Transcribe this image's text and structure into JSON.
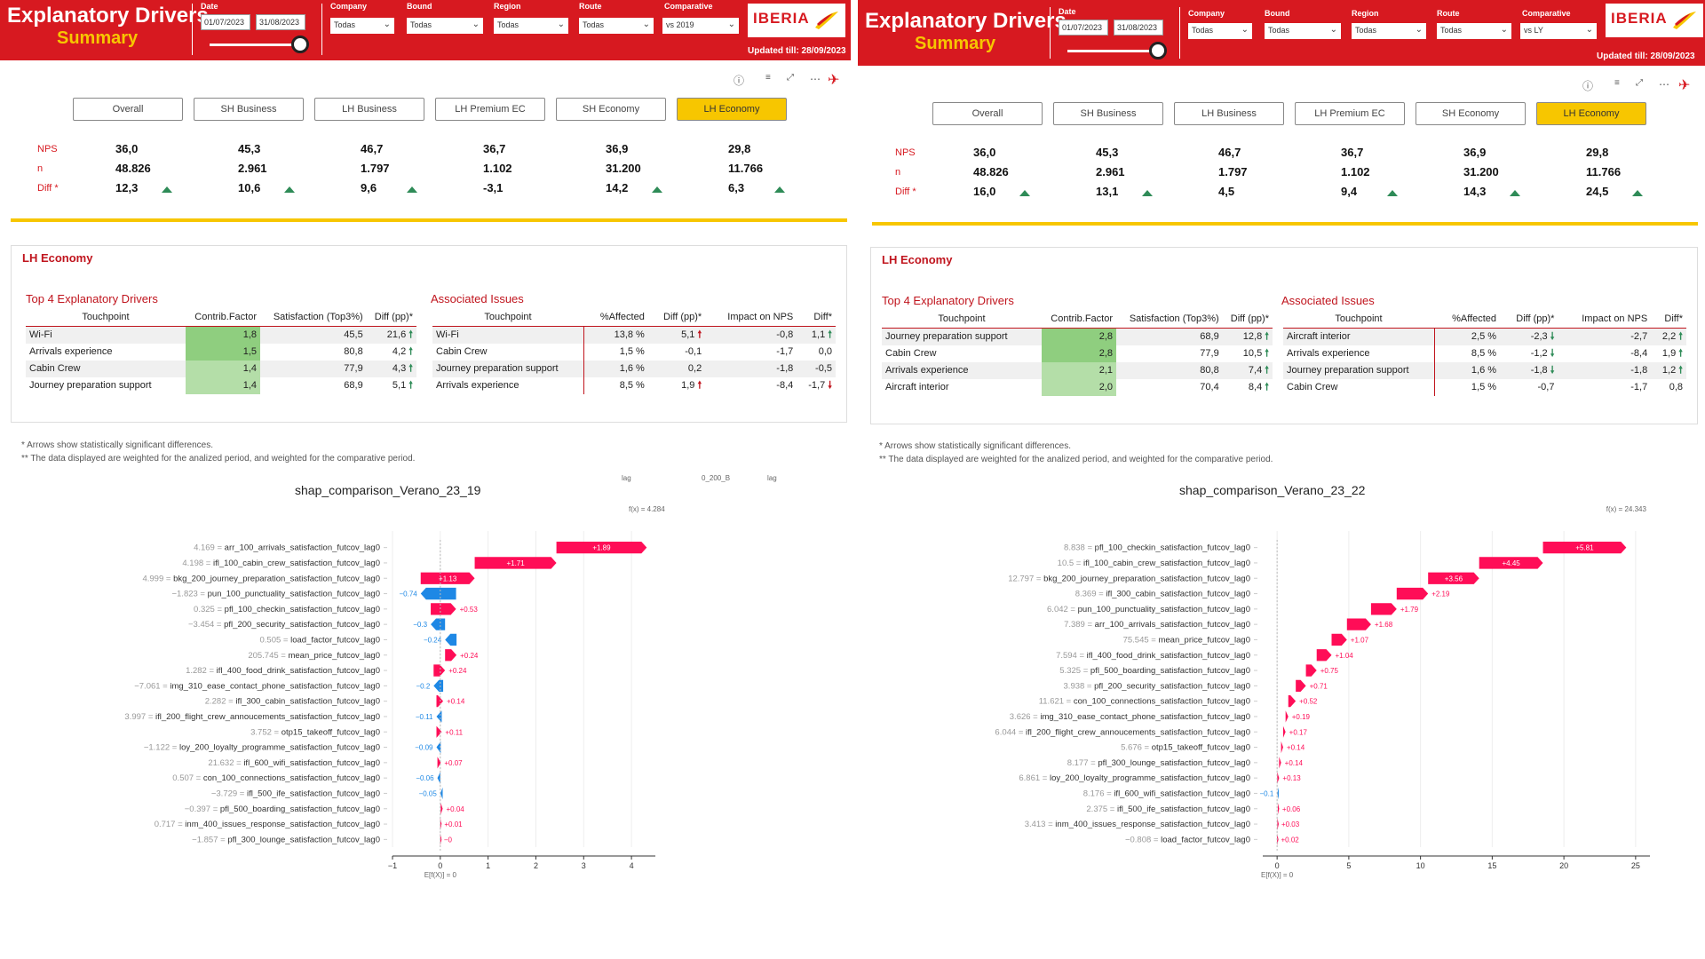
{
  "left": {
    "header": {
      "title": "Explanatory Drivers",
      "subtitle": "Summary",
      "date_label": "Date",
      "date_from": "01/07/2023",
      "date_to": "31/08/2023",
      "filters": [
        {
          "label": "Company",
          "value": "Todas"
        },
        {
          "label": "Bound",
          "value": "Todas"
        },
        {
          "label": "Region",
          "value": "Todas"
        },
        {
          "label": "Route",
          "value": "Todas"
        },
        {
          "label": "Comparative",
          "value": "vs 2019"
        }
      ],
      "logo": "IBERIA",
      "updated": "Updated till: 28/09/2023"
    },
    "tabs": [
      "Overall",
      "SH Business",
      "LH Business",
      "LH Premium EC",
      "SH Economy",
      "LH Economy"
    ],
    "active_tab": 5,
    "kpi": {
      "labels": [
        "NPS",
        "n",
        "Diff *"
      ],
      "cols": [
        [
          "36,0",
          "48.826",
          "12,3"
        ],
        [
          "45,3",
          "2.961",
          "10,6"
        ],
        [
          "46,7",
          "1.797",
          "9,6"
        ],
        [
          "36,7",
          "1.102",
          "-3,1"
        ],
        [
          "36,9",
          "31.200",
          "14,2"
        ],
        [
          "29,8",
          "11.766",
          "6,3"
        ]
      ],
      "diff_arrow": [
        true,
        true,
        true,
        false,
        true,
        true
      ]
    },
    "card_title": "LH Economy",
    "drivers_title": "Top 4 Explanatory Drivers",
    "drivers_headers": [
      "Touchpoint",
      "Contrib.Factor",
      "Satisfaction (Top3%)",
      "Diff (pp)*"
    ],
    "drivers": [
      {
        "tp": "Wi-Fi",
        "cf": "1,8",
        "sat": "45,5",
        "diff": "21,6",
        "arrow": "up-green"
      },
      {
        "tp": "Arrivals experience",
        "cf": "1,5",
        "sat": "80,8",
        "diff": "4,2",
        "arrow": "up-green"
      },
      {
        "tp": "Cabin Crew",
        "cf": "1,4",
        "sat": "77,9",
        "diff": "4,3",
        "arrow": "up-green"
      },
      {
        "tp": "Journey preparation support",
        "cf": "1,4",
        "sat": "68,9",
        "diff": "5,1",
        "arrow": "up-green"
      }
    ],
    "issues_title": "Associated Issues",
    "issues_headers": [
      "Touchpoint",
      "%Affected",
      "Diff (pp)*",
      "Impact on NPS",
      "Diff*"
    ],
    "issues": [
      {
        "tp": "Wi-Fi",
        "aff": "13,8 %",
        "diff": "5,1",
        "a1": "up-red",
        "imp": "-0,8",
        "d2": "1,1",
        "a2": "up-green"
      },
      {
        "tp": "Cabin Crew",
        "aff": "1,5 %",
        "diff": "-0,1",
        "a1": "",
        "imp": "-1,7",
        "d2": "0,0",
        "a2": ""
      },
      {
        "tp": "Journey preparation support",
        "aff": "1,6 %",
        "diff": "0,2",
        "a1": "",
        "imp": "-1,8",
        "d2": "-0,5",
        "a2": ""
      },
      {
        "tp": "Arrivals experience",
        "aff": "8,5 %",
        "diff": "1,9",
        "a1": "up-red",
        "imp": "-8,4",
        "d2": "-1,7",
        "a2": "down-red"
      }
    ],
    "notes": [
      "* Arrows show statistically significant differences.",
      "** The data displayed are weighted for the analized period, and weighted for the comparative period."
    ],
    "stray_glyphs": [
      "lag",
      "0_200_B",
      "lag"
    ]
  },
  "right": {
    "header": {
      "title": "Explanatory Drivers",
      "subtitle": "Summary",
      "date_label": "Date",
      "date_from": "01/07/2023",
      "date_to": "31/08/2023",
      "filters": [
        {
          "label": "Company",
          "value": "Todas"
        },
        {
          "label": "Bound",
          "value": "Todas"
        },
        {
          "label": "Region",
          "value": "Todas"
        },
        {
          "label": "Route",
          "value": "Todas"
        },
        {
          "label": "Comparative",
          "value": "vs LY"
        }
      ],
      "logo": "IBERIA",
      "updated": "Updated till: 28/09/2023"
    },
    "tabs": [
      "Overall",
      "SH Business",
      "LH Business",
      "LH Premium EC",
      "SH Economy",
      "LH Economy"
    ],
    "active_tab": 5,
    "kpi": {
      "labels": [
        "NPS",
        "n",
        "Diff *"
      ],
      "cols": [
        [
          "36,0",
          "48.826",
          "16,0"
        ],
        [
          "45,3",
          "2.961",
          "13,1"
        ],
        [
          "46,7",
          "1.797",
          "4,5"
        ],
        [
          "36,7",
          "1.102",
          "9,4"
        ],
        [
          "36,9",
          "31.200",
          "14,3"
        ],
        [
          "29,8",
          "11.766",
          "24,5"
        ]
      ],
      "diff_arrow": [
        true,
        true,
        false,
        true,
        true,
        true
      ]
    },
    "card_title": "LH Economy",
    "drivers_title": "Top 4 Explanatory Drivers",
    "drivers_headers": [
      "Touchpoint",
      "Contrib.Factor",
      "Satisfaction (Top3%)",
      "Diff (pp)*"
    ],
    "drivers": [
      {
        "tp": "Journey preparation support",
        "cf": "2,8",
        "sat": "68,9",
        "diff": "12,8",
        "arrow": "up-green"
      },
      {
        "tp": "Cabin Crew",
        "cf": "2,8",
        "sat": "77,9",
        "diff": "10,5",
        "arrow": "up-green"
      },
      {
        "tp": "Arrivals experience",
        "cf": "2,1",
        "sat": "80,8",
        "diff": "7,4",
        "arrow": "up-green"
      },
      {
        "tp": "Aircraft interior",
        "cf": "2,0",
        "sat": "70,4",
        "diff": "8,4",
        "arrow": "up-green"
      }
    ],
    "issues_title": "Associated Issues",
    "issues_headers": [
      "Touchpoint",
      "%Affected",
      "Diff (pp)*",
      "Impact on NPS",
      "Diff*"
    ],
    "issues": [
      {
        "tp": "Aircraft interior",
        "aff": "2,5 %",
        "diff": "-2,3",
        "a1": "down-green",
        "imp": "-2,7",
        "d2": "2,2",
        "a2": "up-green"
      },
      {
        "tp": "Arrivals experience",
        "aff": "8,5 %",
        "diff": "-1,2",
        "a1": "down-green",
        "imp": "-8,4",
        "d2": "1,9",
        "a2": "up-green"
      },
      {
        "tp": "Journey preparation support",
        "aff": "1,6 %",
        "diff": "-1,8",
        "a1": "down-green",
        "imp": "-1,8",
        "d2": "1,2",
        "a2": "up-green"
      },
      {
        "tp": "Cabin Crew",
        "aff": "1,5 %",
        "diff": "-0,7",
        "a1": "",
        "imp": "-1,7",
        "d2": "0,8",
        "a2": ""
      }
    ],
    "notes": [
      "* Arrows show statistically significant differences.",
      "** The data displayed are weighted for the analized period, and weighted for the comparative period."
    ]
  },
  "chart_data": [
    {
      "type": "bar",
      "title": "shap_comparison_Verano_23_19",
      "fx_label": "f(x) = 4.284",
      "base_label": "E[f(X)] = 0",
      "xlim": [
        -1,
        4.5
      ],
      "xticks": [
        -1,
        0,
        1,
        2,
        3,
        4
      ],
      "rows": [
        {
          "feature": "arr_100_arrivals_satisfaction_futcov_lag0",
          "value": "4.169",
          "shap": 1.89
        },
        {
          "feature": "ifl_100_cabin_crew_satisfaction_futcov_lag0",
          "value": "4.198",
          "shap": 1.71
        },
        {
          "feature": "bkg_200_journey_preparation_satisfaction_futcov_lag0",
          "value": "4.999",
          "shap": 1.13
        },
        {
          "feature": "pun_100_punctuality_satisfaction_futcov_lag0",
          "value": "−1.823",
          "shap": -0.74
        },
        {
          "feature": "pfl_100_checkin_satisfaction_futcov_lag0",
          "value": "0.325",
          "shap": 0.53
        },
        {
          "feature": "pfl_200_security_satisfaction_futcov_lag0",
          "value": "−3.454",
          "shap": -0.3
        },
        {
          "feature": "load_factor_futcov_lag0",
          "value": "0.505",
          "shap": -0.24
        },
        {
          "feature": "mean_price_futcov_lag0",
          "value": "205.745",
          "shap": 0.24
        },
        {
          "feature": "ifl_400_food_drink_satisfaction_futcov_lag0",
          "value": "1.282",
          "shap": 0.24
        },
        {
          "feature": "img_310_ease_contact_phone_satisfaction_futcov_lag0",
          "value": "−7.061",
          "shap": -0.2
        },
        {
          "feature": "ifl_300_cabin_satisfaction_futcov_lag0",
          "value": "2.282",
          "shap": 0.14
        },
        {
          "feature": "ifl_200_flight_crew_annoucements_satisfaction_futcov_lag0",
          "value": "3.997",
          "shap": -0.11
        },
        {
          "feature": "otp15_takeoff_futcov_lag0",
          "value": "3.752",
          "shap": 0.11
        },
        {
          "feature": "loy_200_loyalty_programme_satisfaction_futcov_lag0",
          "value": "−1.122",
          "shap": -0.09
        },
        {
          "feature": "ifl_600_wifi_satisfaction_futcov_lag0",
          "value": "21.632",
          "shap": 0.07
        },
        {
          "feature": "con_100_connections_satisfaction_futcov_lag0",
          "value": "0.507",
          "shap": -0.06
        },
        {
          "feature": "ifl_500_ife_satisfaction_futcov_lag0",
          "value": "−3.729",
          "shap": -0.05
        },
        {
          "feature": "pfl_500_boarding_satisfaction_futcov_lag0",
          "value": "−0.397",
          "shap": 0.04
        },
        {
          "feature": "inm_400_issues_response_satisfaction_futcov_lag0",
          "value": "0.717",
          "shap": 0.01
        },
        {
          "feature": "pfl_300_lounge_satisfaction_futcov_lag0",
          "value": "−1.857",
          "shap": -0.0
        }
      ],
      "label_texts": [
        "+1.89",
        "+1.71",
        "+1.13",
        "−0.74",
        "+0.53",
        "−0.3",
        "−0.24",
        "+0.24",
        "+0.24",
        "−0.2",
        "+0.14",
        "−0.11",
        "+0.11",
        "−0.09",
        "+0.07",
        "−0.06",
        "−0.05",
        "+0.04",
        "+0.01",
        "−0"
      ],
      "colors": {
        "pos": "#ff0d57",
        "neg": "#1e88e5"
      }
    },
    {
      "type": "bar",
      "title": "shap_comparison_Verano_23_22",
      "fx_label": "f(x) = 24.343",
      "base_label": "E[f(X)] = 0",
      "xlim": [
        -1,
        26
      ],
      "xticks": [
        0,
        5,
        10,
        15,
        20,
        25
      ],
      "rows": [
        {
          "feature": "pfl_100_checkin_satisfaction_futcov_lag0",
          "value": "8.838",
          "shap": 5.81
        },
        {
          "feature": "ifl_100_cabin_crew_satisfaction_futcov_lag0",
          "value": "10.5",
          "shap": 4.45
        },
        {
          "feature": "bkg_200_journey_preparation_satisfaction_futcov_lag0",
          "value": "12.797",
          "shap": 3.56
        },
        {
          "feature": "ifl_300_cabin_satisfaction_futcov_lag0",
          "value": "8.369",
          "shap": 2.19
        },
        {
          "feature": "pun_100_punctuality_satisfaction_futcov_lag0",
          "value": "6.042",
          "shap": 1.79
        },
        {
          "feature": "arr_100_arrivals_satisfaction_futcov_lag0",
          "value": "7.389",
          "shap": 1.68
        },
        {
          "feature": "mean_price_futcov_lag0",
          "value": "75.545",
          "shap": 1.07
        },
        {
          "feature": "ifl_400_food_drink_satisfaction_futcov_lag0",
          "value": "7.594",
          "shap": 1.04
        },
        {
          "feature": "pfl_500_boarding_satisfaction_futcov_lag0",
          "value": "5.325",
          "shap": 0.75
        },
        {
          "feature": "pfl_200_security_satisfaction_futcov_lag0",
          "value": "3.938",
          "shap": 0.71
        },
        {
          "feature": "con_100_connections_satisfaction_futcov_lag0",
          "value": "11.621",
          "shap": 0.52
        },
        {
          "feature": "img_310_ease_contact_phone_satisfaction_futcov_lag0",
          "value": "3.626",
          "shap": 0.19
        },
        {
          "feature": "ifl_200_flight_crew_annoucements_satisfaction_futcov_lag0",
          "value": "6.044",
          "shap": 0.17
        },
        {
          "feature": "otp15_takeoff_futcov_lag0",
          "value": "5.676",
          "shap": 0.14
        },
        {
          "feature": "pfl_300_lounge_satisfaction_futcov_lag0",
          "value": "8.177",
          "shap": 0.14
        },
        {
          "feature": "loy_200_loyalty_programme_satisfaction_futcov_lag0",
          "value": "6.861",
          "shap": 0.13
        },
        {
          "feature": "ifl_600_wifi_satisfaction_futcov_lag0",
          "value": "8.176",
          "shap": -0.1
        },
        {
          "feature": "ifl_500_ife_satisfaction_futcov_lag0",
          "value": "2.375",
          "shap": 0.06
        },
        {
          "feature": "inm_400_issues_response_satisfaction_futcov_lag0",
          "value": "3.413",
          "shap": 0.03
        },
        {
          "feature": "load_factor_futcov_lag0",
          "value": "−0.808",
          "shap": 0.02
        }
      ],
      "label_texts": [
        "+5.81",
        "+4.45",
        "+3.56",
        "+2.19",
        "+1.79",
        "+1.68",
        "+1.07",
        "+1.04",
        "+0.75",
        "+0.71",
        "+0.52",
        "+0.19",
        "+0.17",
        "+0.14",
        "+0.14",
        "+0.13",
        "−0.1",
        "+0.06",
        "+0.03",
        "+0.02"
      ],
      "colors": {
        "pos": "#ff0d57",
        "neg": "#1e88e5"
      }
    }
  ]
}
